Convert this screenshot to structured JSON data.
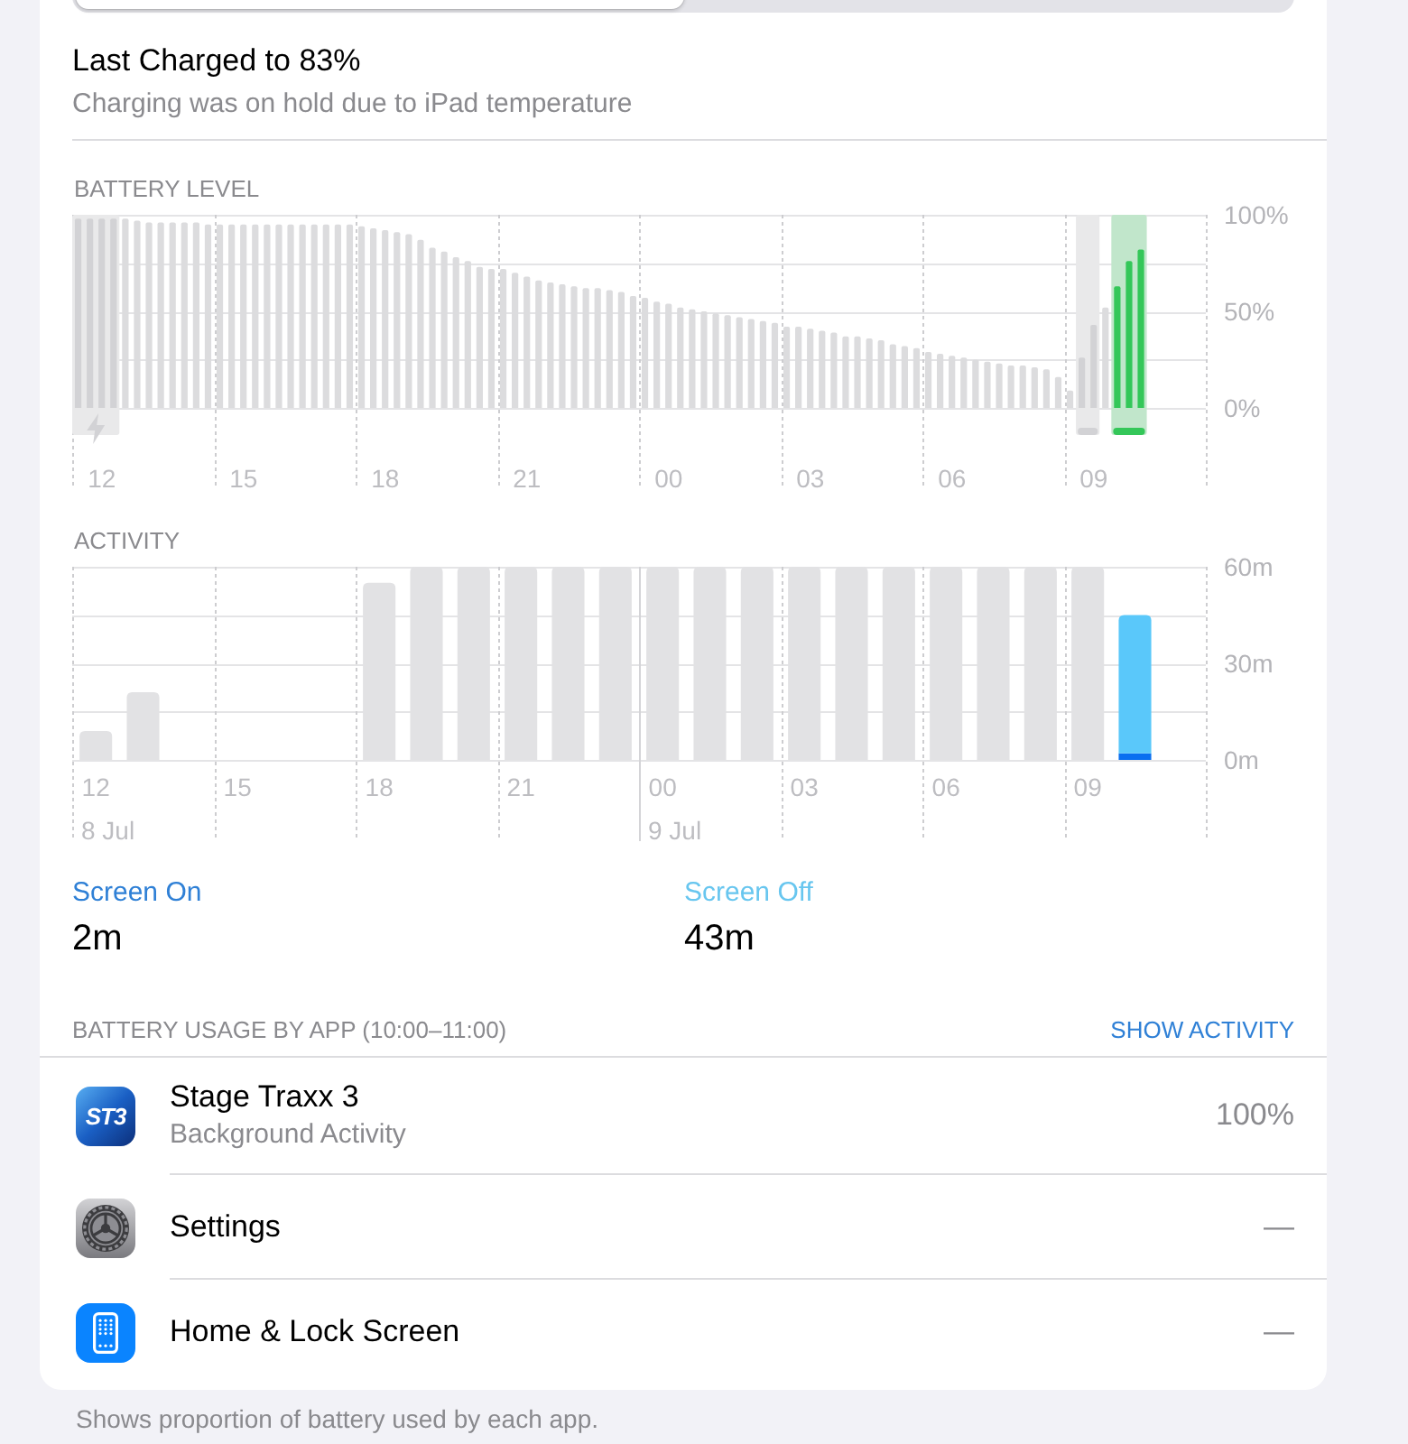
{
  "segmented_control": {
    "segments": [
      {
        "selected": true
      },
      {
        "selected": false
      }
    ]
  },
  "charge_status": {
    "title": "Last Charged to 83%",
    "subtitle": "Charging was on hold due to iPad temperature"
  },
  "battery_level": {
    "chart_data": {
      "type": "bar",
      "title": "BATTERY LEVEL",
      "categories": [
        null,
        null,
        "12",
        null,
        null,
        null,
        null,
        null,
        null,
        null,
        null,
        null,
        null,
        null,
        "15",
        null,
        null,
        null,
        null,
        null,
        null,
        null,
        null,
        null,
        null,
        null,
        "18",
        null,
        null,
        null,
        null,
        null,
        null,
        null,
        null,
        null,
        null,
        null,
        "21",
        null,
        null,
        null,
        null,
        null,
        null,
        null,
        null,
        null,
        null,
        null,
        "00",
        null,
        null,
        null,
        null,
        null,
        null,
        null,
        null,
        null,
        null,
        null,
        "03",
        null,
        null,
        null,
        null,
        null,
        null,
        null,
        null,
        null,
        null,
        null,
        "06",
        null,
        null,
        null,
        null,
        null,
        null,
        null,
        null,
        null,
        null,
        null,
        "09",
        null,
        null,
        null,
        null,
        null,
        null,
        null,
        null,
        null
      ],
      "ylim": [
        0,
        100
      ],
      "yticks": [
        {
          "value": 0,
          "label": "0%"
        },
        {
          "value": 50,
          "label": "50%"
        },
        {
          "value": 100,
          "label": "100%"
        }
      ],
      "series": [
        {
          "color": "#dcdcde",
          "values": [
            null,
            null,
            null,
            null,
            98,
            97,
            96,
            96,
            96,
            96,
            96,
            95,
            95,
            95,
            95,
            95,
            95,
            95,
            95,
            95,
            95,
            95,
            95,
            95,
            94,
            93,
            92,
            91,
            90,
            87,
            83,
            81,
            78,
            76,
            73,
            72,
            72,
            70,
            68,
            66,
            65,
            64,
            63,
            62,
            62,
            61,
            60,
            58,
            57,
            55,
            54,
            52,
            51,
            50,
            49,
            48,
            47,
            46,
            45,
            44,
            42,
            42,
            41,
            40,
            39,
            37,
            37,
            36,
            35,
            33,
            32,
            31,
            29,
            28,
            27,
            26,
            25,
            24,
            23,
            22,
            22,
            21,
            20,
            16,
            9,
            null,
            null,
            52,
            null,
            null,
            null,
            null,
            null,
            null,
            null,
            null
          ]
        },
        {
          "color": "#d2d2d5",
          "values": [
            98,
            98,
            98,
            98,
            null,
            null,
            null,
            null,
            null,
            null,
            null,
            null,
            null,
            null,
            null,
            null,
            null,
            null,
            null,
            null,
            null,
            null,
            null,
            null,
            null,
            null,
            null,
            null,
            null,
            null,
            null,
            null,
            null,
            null,
            null,
            null,
            null,
            null,
            null,
            null,
            null,
            null,
            null,
            null,
            null,
            null,
            null,
            null,
            null,
            null,
            null,
            null,
            null,
            null,
            null,
            null,
            null,
            null,
            null,
            null,
            null,
            null,
            null,
            null,
            null,
            null,
            null,
            null,
            null,
            null,
            null,
            null,
            null,
            null,
            null,
            null,
            null,
            null,
            null,
            null,
            null,
            null,
            null,
            null,
            null,
            26,
            43,
            null,
            null,
            null,
            null,
            null,
            null,
            null,
            null,
            null
          ]
        },
        {
          "color": "#34c759",
          "values": [
            null,
            null,
            null,
            null,
            null,
            null,
            null,
            null,
            null,
            null,
            null,
            null,
            null,
            null,
            null,
            null,
            null,
            null,
            null,
            null,
            null,
            null,
            null,
            null,
            null,
            null,
            null,
            null,
            null,
            null,
            null,
            null,
            null,
            null,
            null,
            null,
            null,
            null,
            null,
            null,
            null,
            null,
            null,
            null,
            null,
            null,
            null,
            null,
            null,
            null,
            null,
            null,
            null,
            null,
            null,
            null,
            null,
            null,
            null,
            null,
            null,
            null,
            null,
            null,
            null,
            null,
            null,
            null,
            null,
            null,
            null,
            null,
            null,
            null,
            null,
            null,
            null,
            null,
            null,
            null,
            null,
            null,
            null,
            null,
            null,
            null,
            null,
            null,
            63,
            76,
            82,
            null,
            null,
            null,
            null,
            null
          ]
        }
      ]
    }
  },
  "activity": {
    "chart_data": {
      "type": "bar",
      "title": "ACTIVITY",
      "stacked": true,
      "categories": [
        "12",
        null,
        null,
        "15",
        null,
        null,
        "18",
        null,
        null,
        "21",
        null,
        null,
        "00",
        null,
        null,
        "03",
        null,
        null,
        "06",
        null,
        null,
        "09",
        null,
        null
      ],
      "ylim": [
        0,
        60
      ],
      "yticks": [
        {
          "value": 0,
          "label": "0m"
        },
        {
          "value": 30,
          "label": "30m"
        },
        {
          "value": 60,
          "label": "60m"
        }
      ],
      "series": [
        {
          "color": "#e2e2e4",
          "values": [
            9,
            21,
            0,
            0,
            0,
            0,
            55,
            60,
            60,
            60,
            60,
            60,
            60,
            60,
            60,
            60,
            60,
            60,
            60,
            60,
            60,
            60,
            null,
            null
          ]
        },
        {
          "color": "#0a6ff0",
          "values": [
            null,
            null,
            null,
            null,
            null,
            null,
            null,
            null,
            null,
            null,
            null,
            null,
            null,
            null,
            null,
            null,
            null,
            null,
            null,
            null,
            null,
            null,
            2,
            null
          ]
        },
        {
          "color": "#5ac8fa",
          "values": [
            null,
            null,
            null,
            null,
            null,
            null,
            null,
            null,
            null,
            null,
            null,
            null,
            null,
            null,
            null,
            null,
            null,
            null,
            null,
            null,
            null,
            null,
            43,
            null
          ]
        }
      ],
      "annotations": [
        "8 Jul",
        "9 Jul"
      ]
    }
  },
  "screen_time": [
    {
      "label": "Screen On",
      "value": "2m",
      "color": "#2f80d6"
    },
    {
      "label": "Screen Off",
      "value": "43m",
      "color": "#68c6ef"
    }
  ],
  "usage": {
    "heading": "BATTERY USAGE BY APP (10:00–11:00)",
    "action": "SHOW ACTIVITY",
    "apps": [
      {
        "kind": "logo",
        "icon_text": "ST3",
        "name": "Stage Traxx 3",
        "detail": "Background Activity",
        "share": "100%"
      },
      {
        "kind": "gear",
        "name": "Settings",
        "share": "—"
      },
      {
        "kind": "tablet",
        "name": "Home & Lock Screen",
        "share": "—"
      }
    ]
  },
  "footer": "Shows proportion of battery used by each app."
}
